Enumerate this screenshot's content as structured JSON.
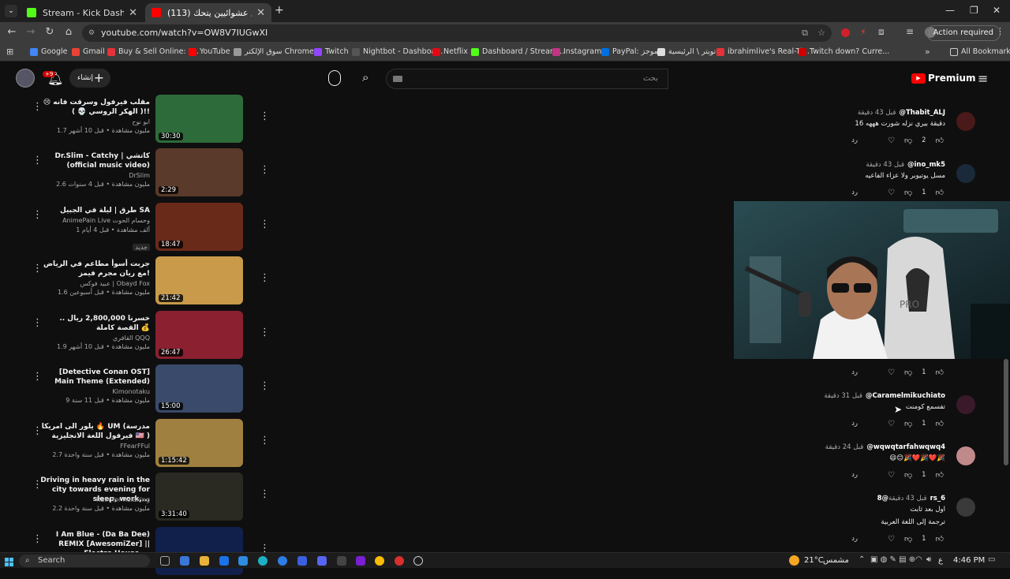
{
  "browser": {
    "tabs": [
      {
        "title": "Stream - Kick Dashboard",
        "color": "#53fc18"
      },
      {
        "title": "(113) خليت ناس عشوائيين يتحك...",
        "color": "#ff0000"
      }
    ],
    "url": "youtube.com/watch?v=OW8V7IUGwXI",
    "action_required": "Action required",
    "bookmarks": [
      {
        "label": "Google",
        "color": "#4285f4"
      },
      {
        "label": "Gmail",
        "color": "#ea4335"
      },
      {
        "label": "Buy & Sell Online: P...",
        "color": "#e53238"
      },
      {
        "label": "YouTube",
        "color": "#ff0000"
      },
      {
        "label": "سوق الإلكتر Chrome...",
        "color": "#999999"
      },
      {
        "label": "Twitch",
        "color": "#9146ff"
      },
      {
        "label": "Nightbot - Dashboa...",
        "color": "#555555"
      },
      {
        "label": "Netflix",
        "color": "#e50914"
      },
      {
        "label": "Dashboard / Stream...",
        "color": "#53fc18"
      },
      {
        "label": "Instagram",
        "color": "#c13584"
      },
      {
        "label": "PayPal: الموجز",
        "color": "#0070e0"
      },
      {
        "label": "تويتر \\ الرئيسية",
        "color": "#dddddd"
      },
      {
        "label": "ibrahimlive's Real-Ti...",
        "color": "#e53238"
      },
      {
        "label": "Twitch down? Curre...",
        "color": "#d00000"
      }
    ],
    "all_bookmarks": "All Bookmarks"
  },
  "youtube": {
    "logo_text": "Premium",
    "search_placeholder": "بحث",
    "create_label": "إنشاء",
    "notifications_badge": "+9"
  },
  "videos": [
    {
      "title": "مقلب فيرفول وسرقت فانه 😢 !!( الهكر الروسي 💀 )",
      "channel": "ابو نوح",
      "meta": "1.7 مليون مشاهدة • قبل 10 أشهر",
      "duration": "30:30",
      "thumb": "#2e6b3a"
    },
    {
      "title": "Dr.Slim - Catchy | كاتشي (official music video)",
      "channel": "DrSlim",
      "meta": "2.6 مليون مشاهدة • قبل 4 سنوات",
      "duration": "2:29",
      "thumb": "#5a3a2a"
    },
    {
      "title": "طرق | ليلة في الجبيل SA",
      "channel": "AnimePain Live وحسام الحوت",
      "meta": "1 ألف مشاهدة • قبل 4 أيام",
      "extra": "جديد",
      "duration": "18:47",
      "thumb": "#6a2a1a"
    },
    {
      "title": "جربت أسوأ مطاعم في الرياض مع ريان مجرم فيمز!",
      "channel": "عبيد فوكس | Obayd Fox",
      "meta": "1.6 مليون مشاهدة • قبل أسبوعين",
      "duration": "21:42",
      "thumb": "#c89a4a"
    },
    {
      "title": "خسرنا 2,800,000 ريال .. القصة كاملة 💰",
      "channel": "القافري QQQ",
      "meta": "1.9 مليون مشاهدة • قبل 10 أشهر",
      "duration": "26:47",
      "thumb": "#8a2030"
    },
    {
      "title": "[Detective Conan OST] Main Theme (Extended)",
      "channel": "Kimonotaku",
      "meta": "9 مليون مشاهدة • قبل 11 سنة",
      "duration": "15:00",
      "thumb": "#3a4a6a"
    },
    {
      "title": "يلور الى امريكا 🔥 UM (مدرسة فيرفول اللغة الانجليزية 🇺🇸 )",
      "channel": "FFearFFul",
      "meta": "2.7 مليون مشاهدة • قبل سنة واحدة",
      "duration": "1:15:42",
      "thumb": "#a08040"
    },
    {
      "title": "Driving in heavy rain in the city towards evening for sleep, work,...",
      "channel": "Rain for Relaxing",
      "meta": "2.2 مليون مشاهدة • قبل سنة واحدة",
      "duration": "3:31:40",
      "thumb": "#2a2a22"
    },
    {
      "title": "I Am Blue - (Da Ba Dee) REMIX [AwesomiZer] || Electro House ...",
      "channel": "",
      "meta": "",
      "duration": "",
      "thumb": "#10204a"
    }
  ],
  "comments": [
    {
      "user": "@Thabit_ALJ",
      "time": "قبل 43 دقيقة",
      "text": "16 دقيقة بيري نزله شورت هههه",
      "likes": "2",
      "reply": "رد",
      "avatar": "#4a1a1a"
    },
    {
      "user": "@ino_mk5",
      "time": "قبل 43 دقيقة",
      "text": "مسل يوتيوبر ولا عزاء الفاعيه",
      "likes": "1",
      "reply": "رد",
      "avatar": "#1a2a3a"
    },
    {
      "user": "",
      "time": "",
      "text": "",
      "likes": "1",
      "reply": "رد",
      "avatar": "#1a1a1a"
    },
    {
      "user": "@Caramelmikuchiato",
      "time": "قبل 31 دقيقة",
      "text": "تفسمع كومنت",
      "likes": "1",
      "reply": "رد",
      "avatar": "#3a1a2a"
    },
    {
      "user": "@wqwqtarfahwqwq4",
      "time": "قبل 24 دقيقة",
      "text": "😄😊🎉❤️🎉❤️🎉",
      "likes": "1",
      "reply": "رد",
      "avatar": "#c08a8a"
    },
    {
      "user": "@8rs_6",
      "time": "قبل 43 دقيقة",
      "text": "اول بعد ثابت",
      "translate": "ترجمة إلى اللغة العربية",
      "likes": "1",
      "reply": "رد",
      "avatar": "#3a3a3a"
    }
  ],
  "taskbar": {
    "search": "Search",
    "weather": "21°C",
    "weather_text": "مشمس",
    "lang": "ع",
    "time": "4:46 PM"
  }
}
